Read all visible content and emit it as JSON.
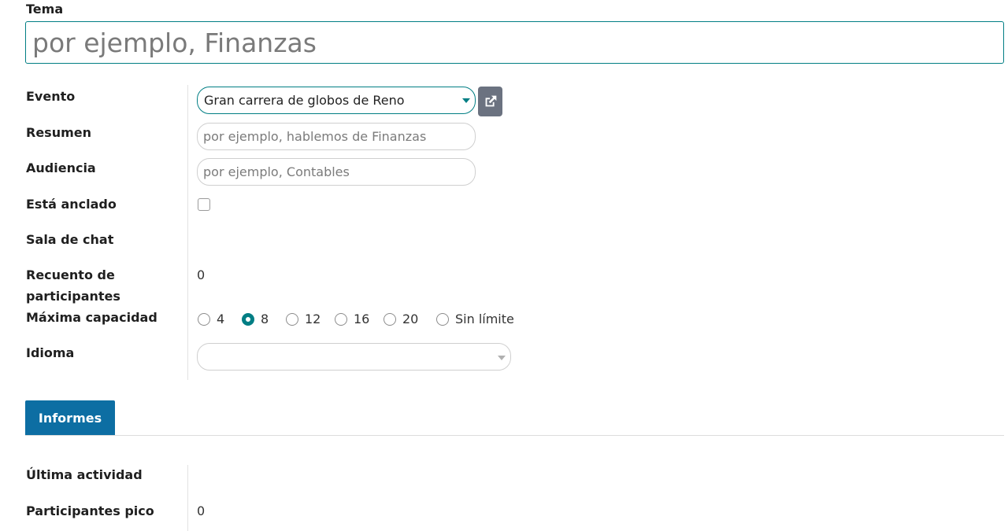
{
  "title": {
    "label": "Tema",
    "placeholder": "por ejemplo, Finanzas"
  },
  "fields": {
    "evento": {
      "label": "Evento",
      "value": "Gran carrera de globos de Reno"
    },
    "resumen": {
      "label": "Resumen",
      "placeholder": "por ejemplo, hablemos de Finanzas"
    },
    "audiencia": {
      "label": "Audiencia",
      "placeholder": "por ejemplo, Contables"
    },
    "anclado": {
      "label": "Está anclado",
      "checked": false
    },
    "sala": {
      "label": "Sala de chat"
    },
    "recuento": {
      "label_line1": "Recuento de",
      "label_line2": "participantes",
      "value": "0"
    },
    "capacidad": {
      "label": "Máxima capacidad",
      "options": [
        "4",
        "8",
        "12",
        "16",
        "20",
        "Sin límite"
      ],
      "selected": "8"
    },
    "idioma": {
      "label": "Idioma",
      "value": ""
    }
  },
  "tabs": {
    "informes": "Informes"
  },
  "report": {
    "ultima": {
      "label": "Última actividad"
    },
    "pico": {
      "label": "Participantes pico",
      "value": "0"
    }
  },
  "colors": {
    "accent": "#017e84",
    "tab": "#0d6ea3",
    "ext_button": "#6b7280"
  },
  "icons": {
    "external": "external-link-icon"
  }
}
